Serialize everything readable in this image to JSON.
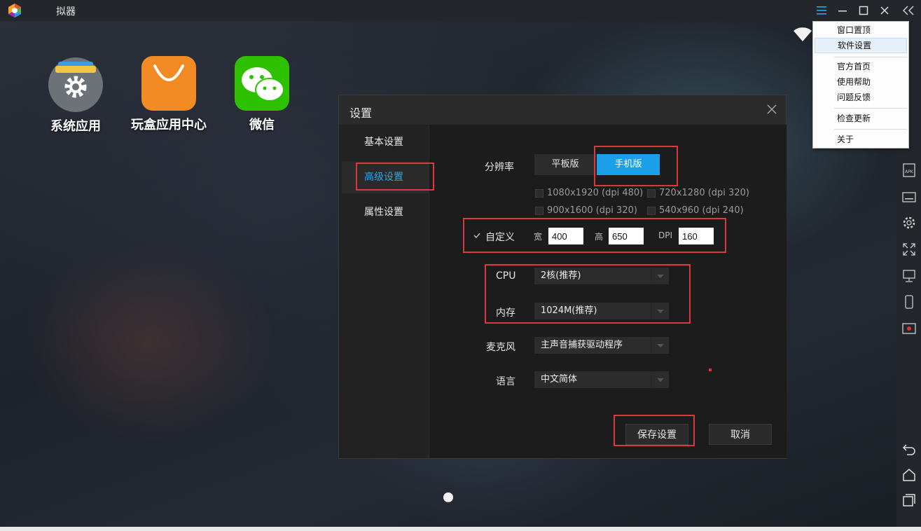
{
  "window": {
    "title": "拟器"
  },
  "desktop": {
    "icons": [
      {
        "label": "系统应用"
      },
      {
        "label": "玩盒应用中心"
      },
      {
        "label": "微信"
      }
    ]
  },
  "menu": {
    "items": [
      "窗口置顶",
      "软件设置",
      "官方首页",
      "使用帮助",
      "问题反馈",
      "检查更新",
      "关于"
    ]
  },
  "dialog": {
    "title": "设置",
    "sidebar": [
      "基本设置",
      "高级设置",
      "属性设置"
    ],
    "active_tab": "高级设置",
    "resolution": {
      "label": "分辨率",
      "tablet": "平板版",
      "phone": "手机版",
      "selected": "手机版",
      "options": [
        "1080x1920 (dpi 480)",
        "720x1280 (dpi 320)",
        "900x1600 (dpi 320)",
        "540x960 (dpi 240)"
      ]
    },
    "custom": {
      "label": "自定义",
      "checked": true,
      "width_label": "宽",
      "width": "400",
      "height_label": "高",
      "height": "650",
      "dpi_label": "DPI",
      "dpi": "160"
    },
    "cpu": {
      "label": "CPU",
      "value": "2核(推荐)"
    },
    "memory": {
      "label": "内存",
      "value": "1024M(推荐)"
    },
    "mic": {
      "label": "麦克风",
      "value": "主声音捕获驱动程序"
    },
    "language": {
      "label": "语言",
      "value": "中文简体"
    },
    "save": "保存设置",
    "cancel": "取消"
  },
  "colors": {
    "accent": "#1a9fe8",
    "active_tab_text": "#2ca6e8",
    "highlight_border": "#d9383f"
  }
}
